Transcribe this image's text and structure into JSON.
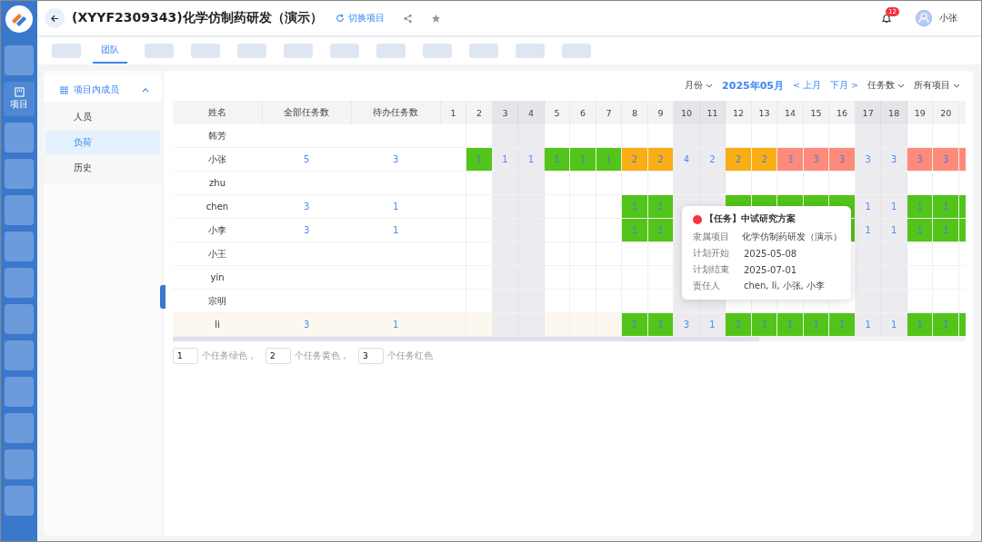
{
  "rail": [
    {
      "selected": false
    },
    {
      "label": "项目",
      "selected": true
    },
    {
      "selected": false
    },
    {
      "selected": false
    },
    {
      "selected": false
    },
    {
      "selected": false
    },
    {
      "selected": false
    },
    {
      "selected": false
    },
    {
      "selected": false
    },
    {
      "selected": false
    },
    {
      "selected": false
    },
    {
      "selected": false
    },
    {
      "selected": false
    }
  ],
  "header": {
    "title": "(XYYF2309343)化学仿制药研发（演示）",
    "switch": "切换项目",
    "badge": "12",
    "user": "小张"
  },
  "tabs": [
    {
      "selected": false
    },
    {
      "label": "团队",
      "selected": true
    },
    {
      "selected": false
    },
    {
      "selected": false
    },
    {
      "selected": false
    },
    {
      "selected": false
    },
    {
      "selected": false
    },
    {
      "selected": false
    },
    {
      "selected": false
    },
    {
      "selected": false
    },
    {
      "selected": false
    },
    {
      "selected": false
    }
  ],
  "sidebar": {
    "group": "项目内成员",
    "expanded": true,
    "items": [
      {
        "label": "人员",
        "selected": false
      },
      {
        "label": "负荷",
        "selected": true
      },
      {
        "label": "历史",
        "selected": false
      }
    ]
  },
  "toolbar": {
    "month_filter": "月份",
    "month": "2025年05月",
    "prev": "< 上月",
    "next": "下月 >",
    "metric": "任务数",
    "project": "所有项目"
  },
  "table": {
    "columns": [
      "姓名",
      "全部任务数",
      "待办任务数"
    ],
    "days": [
      {
        "label": "1",
        "weekend": false
      },
      {
        "label": "2",
        "weekend": false
      },
      {
        "label": "3",
        "weekend": true
      },
      {
        "label": "4",
        "weekend": true
      },
      {
        "label": "5",
        "weekend": false
      },
      {
        "label": "6",
        "weekend": false
      },
      {
        "label": "7",
        "weekend": false
      },
      {
        "label": "8",
        "weekend": false
      },
      {
        "label": "9",
        "weekend": false
      },
      {
        "label": "10",
        "weekend": true
      },
      {
        "label": "11",
        "weekend": true
      },
      {
        "label": "12",
        "weekend": false
      },
      {
        "label": "13",
        "weekend": false
      },
      {
        "label": "14",
        "weekend": false
      },
      {
        "label": "15",
        "weekend": false
      },
      {
        "label": "16",
        "weekend": false
      },
      {
        "label": "17",
        "weekend": true
      },
      {
        "label": "18",
        "weekend": true
      },
      {
        "label": "19",
        "weekend": false
      },
      {
        "label": "20",
        "weekend": false
      },
      {
        "weekend": false
      }
    ],
    "rows": [
      {
        "name": "韩芳",
        "selected": false
      },
      {
        "name": "小张",
        "total": "5",
        "pending": "3",
        "selected": false,
        "cells": [
          {
            "kind": "empty"
          },
          {
            "kind": "green",
            "value": "1"
          },
          {
            "kind": "plain",
            "value": "1"
          },
          {
            "kind": "plain",
            "value": "1"
          },
          {
            "kind": "green",
            "value": "1"
          },
          {
            "kind": "green",
            "value": "1"
          },
          {
            "kind": "green",
            "value": "1"
          },
          {
            "kind": "orange",
            "value": "2"
          },
          {
            "kind": "orange",
            "value": "2"
          },
          {
            "kind": "plain",
            "value": "4"
          },
          {
            "kind": "plain",
            "value": "2"
          },
          {
            "kind": "orange",
            "value": "2"
          },
          {
            "kind": "orange",
            "value": "2"
          },
          {
            "kind": "red",
            "value": "3"
          },
          {
            "kind": "red",
            "value": "3"
          },
          {
            "kind": "red",
            "value": "3"
          },
          {
            "kind": "plain",
            "value": "3"
          },
          {
            "kind": "plain",
            "value": "3"
          },
          {
            "kind": "red",
            "value": "3"
          },
          {
            "kind": "red",
            "value": "3"
          },
          {
            "kind": "red"
          }
        ]
      },
      {
        "name": "zhu",
        "selected": false
      },
      {
        "name": "chen",
        "total": "3",
        "pending": "1",
        "selected": false,
        "cells": [
          {
            "kind": "empty"
          },
          {
            "kind": "empty"
          },
          {
            "kind": "empty"
          },
          {
            "kind": "empty"
          },
          {
            "kind": "empty"
          },
          {
            "kind": "empty"
          },
          {
            "kind": "empty"
          },
          {
            "kind": "green",
            "value": "1"
          },
          {
            "kind": "green",
            "value": "1"
          },
          {
            "kind": "empty"
          },
          {
            "kind": "empty"
          },
          {
            "kind": "green"
          },
          {
            "kind": "green"
          },
          {
            "kind": "green"
          },
          {
            "kind": "green"
          },
          {
            "kind": "green"
          },
          {
            "kind": "plain",
            "value": "1"
          },
          {
            "kind": "plain",
            "value": "1"
          },
          {
            "kind": "green",
            "value": "1"
          },
          {
            "kind": "green",
            "value": "1"
          },
          {
            "kind": "green"
          }
        ]
      },
      {
        "name": "小李",
        "total": "3",
        "pending": "1",
        "selected": false,
        "cells": [
          {
            "kind": "empty"
          },
          {
            "kind": "empty"
          },
          {
            "kind": "empty"
          },
          {
            "kind": "empty"
          },
          {
            "kind": "empty"
          },
          {
            "kind": "empty"
          },
          {
            "kind": "empty"
          },
          {
            "kind": "green",
            "value": "1"
          },
          {
            "kind": "green",
            "value": "1"
          },
          {
            "kind": "empty"
          },
          {
            "kind": "empty"
          },
          {
            "kind": "empty"
          },
          {
            "kind": "empty"
          },
          {
            "kind": "empty"
          },
          {
            "kind": "empty"
          },
          {
            "kind": "green"
          },
          {
            "kind": "plain",
            "value": "1"
          },
          {
            "kind": "plain",
            "value": "1"
          },
          {
            "kind": "green",
            "value": "1"
          },
          {
            "kind": "green",
            "value": "1"
          },
          {
            "kind": "green"
          }
        ]
      },
      {
        "name": "小王",
        "selected": false
      },
      {
        "name": "yin",
        "selected": false
      },
      {
        "name": "宗明",
        "selected": false
      },
      {
        "name": "li",
        "total": "3",
        "pending": "1",
        "selected": true,
        "cells": [
          {
            "kind": "empty"
          },
          {
            "kind": "empty"
          },
          {
            "kind": "empty"
          },
          {
            "kind": "empty"
          },
          {
            "kind": "empty"
          },
          {
            "kind": "empty"
          },
          {
            "kind": "empty"
          },
          {
            "kind": "green",
            "value": "1"
          },
          {
            "kind": "green",
            "value": "1"
          },
          {
            "kind": "plain",
            "value": "3"
          },
          {
            "kind": "plain",
            "value": "1"
          },
          {
            "kind": "green",
            "value": "1"
          },
          {
            "kind": "green",
            "value": "1"
          },
          {
            "kind": "green",
            "value": "1"
          },
          {
            "kind": "green",
            "value": "1"
          },
          {
            "kind": "green",
            "value": "1"
          },
          {
            "kind": "plain",
            "value": "1"
          },
          {
            "kind": "plain",
            "value": "1"
          },
          {
            "kind": "green",
            "value": "1"
          },
          {
            "kind": "green",
            "value": "1"
          },
          {
            "kind": "green"
          }
        ]
      }
    ]
  },
  "tooltip": {
    "title": "【任务】中试研究方案",
    "color": "#f5333f",
    "fields": [
      {
        "label": "隶属项目",
        "value": "化学仿制药研发（演示）"
      },
      {
        "label": "计划开始",
        "value": "2025-05-08"
      },
      {
        "label": "计划结束",
        "value": "2025-07-01"
      },
      {
        "label": "责任人",
        "value": "chen, li, 小张, 小李"
      }
    ]
  },
  "legend": [
    {
      "value": "1",
      "text": "个任务绿色，"
    },
    {
      "value": "2",
      "text": "个任务黄色，"
    },
    {
      "value": "3",
      "text": "个任务红色"
    }
  ]
}
